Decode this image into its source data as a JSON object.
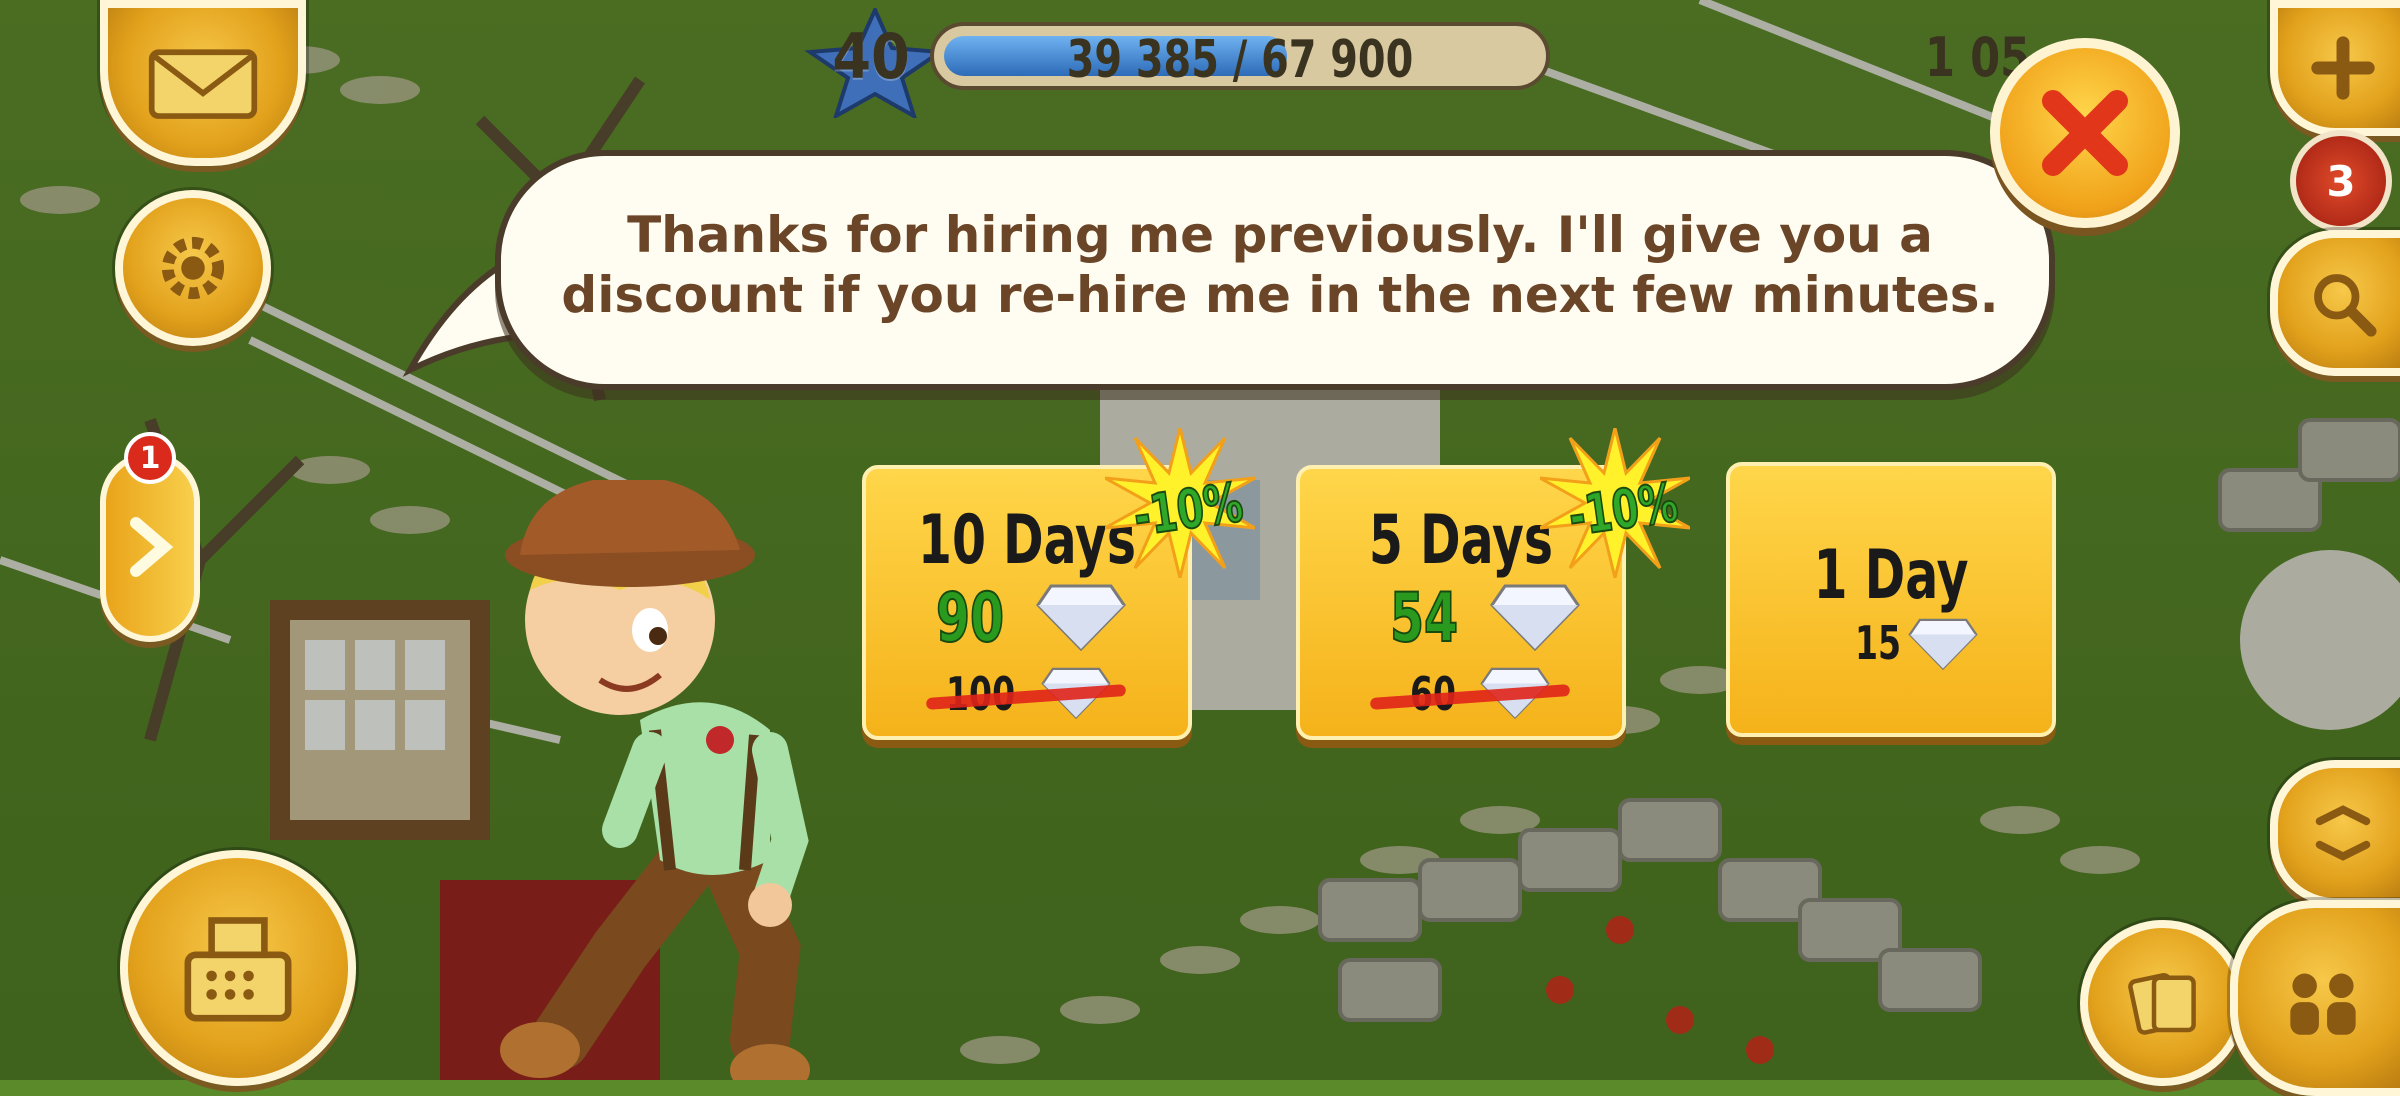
{
  "hud": {
    "level": "40",
    "xp_text": "39 385 / 67 900",
    "xp_progress": 0.58,
    "coins_text": "1 05"
  },
  "dialog": {
    "message_line1": "Thanks for hiring me previously. I'll give you a",
    "message_line2": "discount if you re-hire me in the next few minutes."
  },
  "side_panel": {
    "notification_count": "1"
  },
  "right_badge": {
    "count": "3"
  },
  "hire_options": [
    {
      "title": "10 Days",
      "price": "90",
      "old_price": "100",
      "discount": "-10%"
    },
    {
      "title": "5 Days",
      "price": "54",
      "old_price": "60",
      "discount": "-10%"
    },
    {
      "title": "1 Day",
      "price": "15"
    }
  ],
  "colors": {
    "card": "#f5b21a",
    "price_green": "#2a9a1e",
    "strike_red": "#e0231a",
    "bubble_text": "#6b4527",
    "close_x": "#e2361a"
  },
  "icons": [
    "mail-icon",
    "gear-icon",
    "chevron-right-icon",
    "cash-register-icon",
    "plus-icon",
    "magnifier-icon",
    "map-expand-icon",
    "friends-icon",
    "cards-icon",
    "close-icon",
    "diamond-icon"
  ]
}
